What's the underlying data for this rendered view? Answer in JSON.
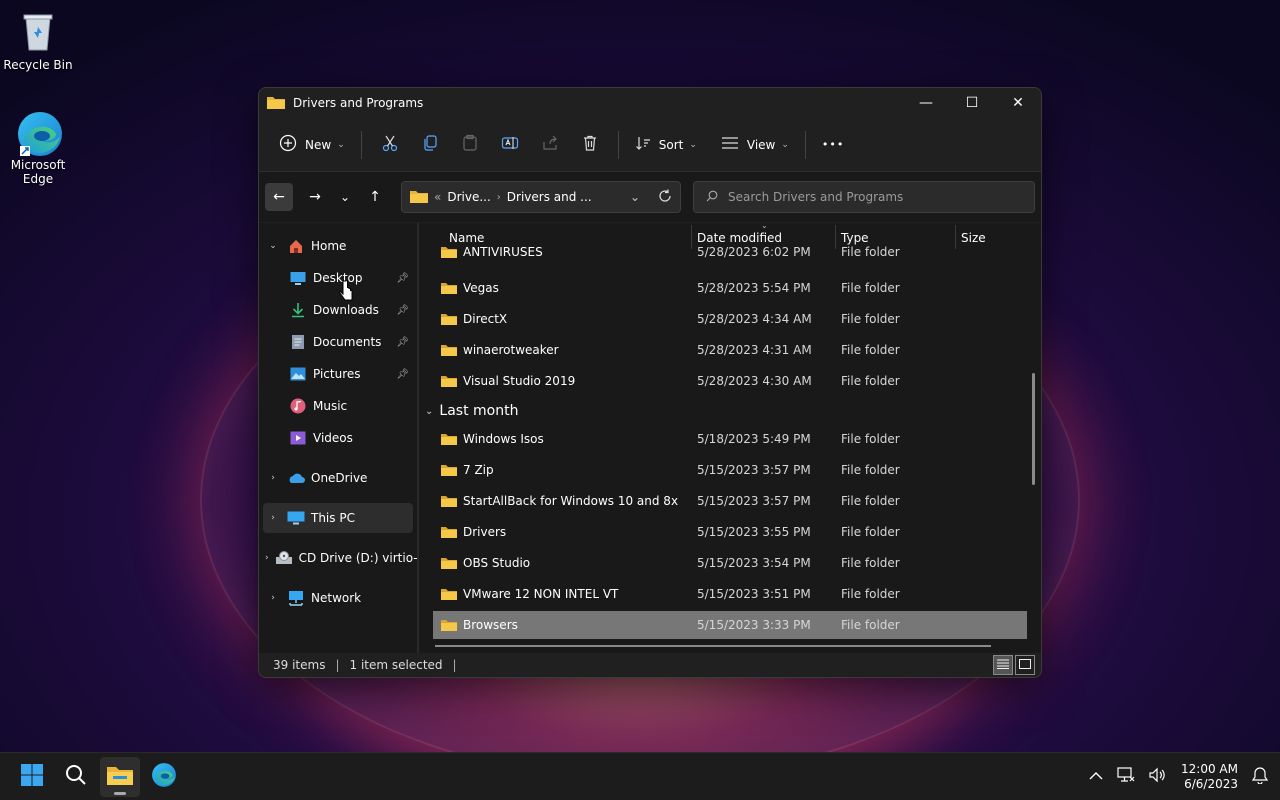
{
  "desktop": {
    "icons": [
      {
        "label": "Recycle Bin",
        "icon": "recycle-bin-icon"
      },
      {
        "label": "Microsoft Edge",
        "label_line1": "Microsoft",
        "label_line2": "Edge",
        "icon": "edge-icon"
      }
    ]
  },
  "window": {
    "title": "Drivers and Programs",
    "controls": {
      "minimize": "—",
      "maximize": "☐",
      "close": "✕"
    }
  },
  "toolbar": {
    "new_label": "New",
    "sort_label": "Sort",
    "view_label": "View",
    "more_label": "•••",
    "icons": [
      "cut-icon",
      "copy-icon",
      "paste-icon",
      "rename-icon",
      "share-icon",
      "delete-icon"
    ]
  },
  "nav": {
    "back": "←",
    "forward": "→",
    "recent": "⌄",
    "up": "↑",
    "address": {
      "prefix": "«",
      "crumb1": "Drive...",
      "crumb2": "Drivers and ..."
    },
    "search_placeholder": "Search Drivers and Programs"
  },
  "sidebar": {
    "items": [
      {
        "label": "Home",
        "icon": "home-icon"
      },
      {
        "label": "Desktop",
        "icon": "desktop-icon",
        "pinned": true
      },
      {
        "label": "Downloads",
        "icon": "downloads-icon",
        "pinned": true
      },
      {
        "label": "Documents",
        "icon": "documents-icon",
        "pinned": true
      },
      {
        "label": "Pictures",
        "icon": "pictures-icon",
        "pinned": true
      },
      {
        "label": "Music",
        "icon": "music-icon"
      },
      {
        "label": "Videos",
        "icon": "videos-icon"
      },
      {
        "label": "OneDrive",
        "icon": "onedrive-icon"
      },
      {
        "label": "This PC",
        "icon": "this-pc-icon"
      },
      {
        "label": "CD Drive (D:) virtio-w",
        "icon": "cd-drive-icon"
      },
      {
        "label": "Network",
        "icon": "network-icon"
      }
    ]
  },
  "columns": {
    "name": "Name",
    "date": "Date modified",
    "type": "Type",
    "size": "Size"
  },
  "groups": {
    "last_month": "Last month"
  },
  "files": [
    {
      "name": "ANTIVIRUSES",
      "date": "5/28/2023 6:02 PM",
      "type": "File folder"
    },
    {
      "name": "Vegas",
      "date": "5/28/2023 5:54 PM",
      "type": "File folder"
    },
    {
      "name": "DirectX",
      "date": "5/28/2023 4:34 AM",
      "type": "File folder"
    },
    {
      "name": "winaerotweaker",
      "date": "5/28/2023 4:31 AM",
      "type": "File folder"
    },
    {
      "name": "Visual Studio 2019",
      "date": "5/28/2023 4:30 AM",
      "type": "File folder"
    },
    {
      "name": "Windows Isos",
      "date": "5/18/2023 5:49 PM",
      "type": "File folder"
    },
    {
      "name": "7 Zip",
      "date": "5/15/2023 3:57 PM",
      "type": "File folder"
    },
    {
      "name": "StartAllBack for Windows 10 and 8x",
      "date": "5/15/2023 3:57 PM",
      "type": "File folder"
    },
    {
      "name": "Drivers",
      "date": "5/15/2023 3:55 PM",
      "type": "File folder"
    },
    {
      "name": "OBS Studio",
      "date": "5/15/2023 3:54 PM",
      "type": "File folder"
    },
    {
      "name": "VMware 12 NON INTEL VT",
      "date": "5/15/2023 3:51 PM",
      "type": "File folder"
    },
    {
      "name": "Browsers",
      "date": "5/15/2023 3:33 PM",
      "type": "File folder",
      "selected": true
    }
  ],
  "status": {
    "items": "39 items",
    "selected": "1 item selected"
  },
  "taskbar": {
    "apps": [
      "start-icon",
      "search-icon",
      "file-explorer-icon",
      "edge-icon"
    ],
    "time": "12:00 AM",
    "date": "6/6/2023"
  },
  "colors": {
    "accent": "#0078d4",
    "folder": "#e8b53a",
    "window_bg": "#191919"
  }
}
